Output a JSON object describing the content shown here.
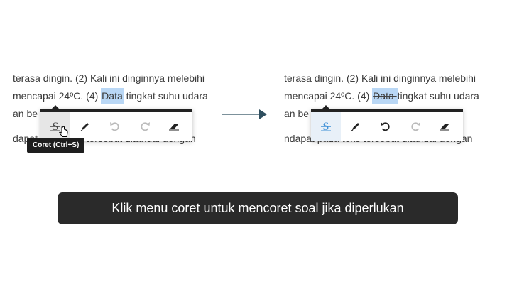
{
  "before": {
    "lines": [
      "terasa dingin. (2) Kali ini dinginnya melebihi",
      "mencapai 24ºC. (4) ",
      "an be",
      "dapat pada teks tersebut ditandai dengan"
    ],
    "highlight_word": "Data",
    "line2_rest": " tingkat suhu udara"
  },
  "after": {
    "lines": [
      "terasa dingin. (2) Kali ini dinginnya melebihi",
      "mencapai 24ºC. (4) ",
      "an be",
      "ndapat pada teks tersebut ditandai dengan"
    ],
    "highlight_word": "Data ",
    "line2_rest": "tingkat suhu udara"
  },
  "toolbar": {
    "tools": [
      {
        "name": "strikethrough",
        "icon": "strikethrough-icon"
      },
      {
        "name": "pencil",
        "icon": "pencil-icon"
      },
      {
        "name": "undo",
        "icon": "undo-icon"
      },
      {
        "name": "redo",
        "icon": "redo-icon"
      },
      {
        "name": "eraser",
        "icon": "eraser-icon"
      }
    ]
  },
  "tooltip": "Coret (Ctrl+S)",
  "caption": "Klik menu coret untuk mencoret soal jika diperlukan",
  "colors": {
    "highlight": "#b9d7f5",
    "active_blue": "#3d8fd6",
    "toolbar_border": "#222222",
    "caption_bg": "#2a2a2a",
    "arrow": "#2f4f5f"
  }
}
